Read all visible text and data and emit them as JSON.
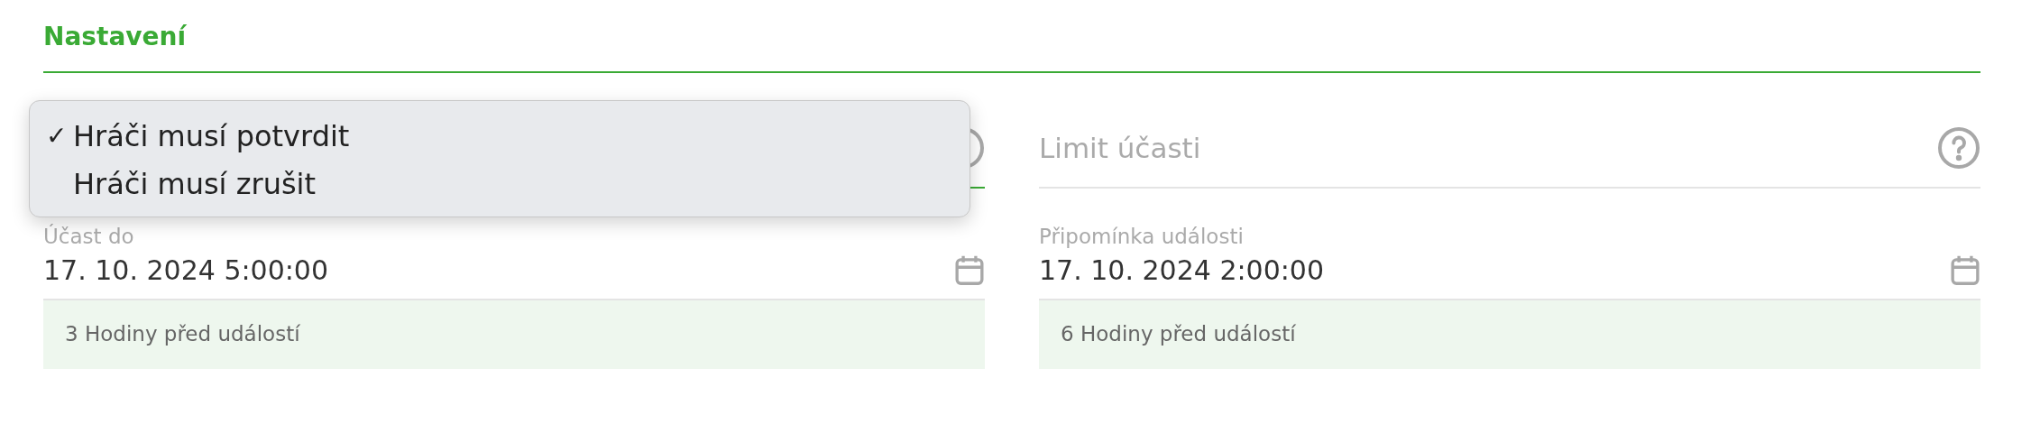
{
  "section": {
    "title": "Nastavení"
  },
  "dropdown": {
    "check_mark": "✓",
    "options": [
      {
        "label": "Hráči musí potvrdit",
        "selected": true
      },
      {
        "label": "Hráči musí zrušit",
        "selected": false
      }
    ]
  },
  "limit_field": {
    "placeholder": "Limit účasti"
  },
  "date_fields": [
    {
      "label": "Účast do",
      "value": "17. 10. 2024 5:00:00",
      "note": "3 Hodiny před událostí"
    },
    {
      "label": "Připomínka události",
      "value": "17. 10. 2024 2:00:00",
      "note": "6 Hodiny před událostí"
    }
  ]
}
